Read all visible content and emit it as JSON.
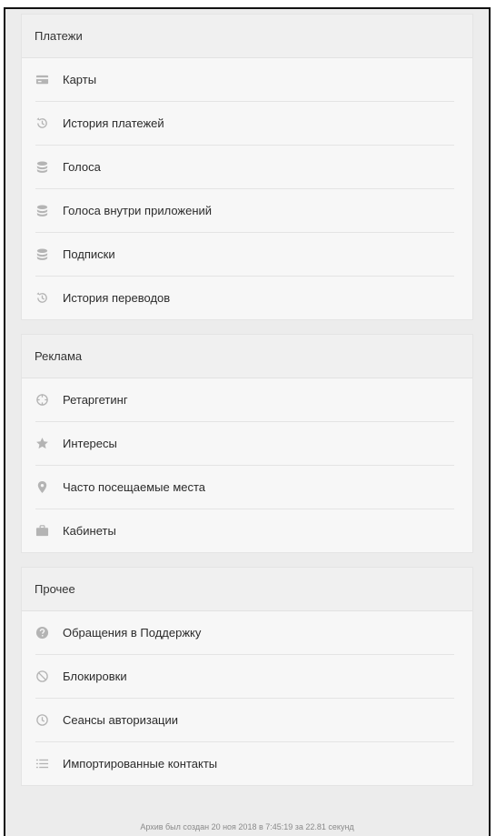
{
  "payments": {
    "title": "Платежи",
    "items": [
      {
        "label": "Карты",
        "icon": "card-icon"
      },
      {
        "label": "История платежей",
        "icon": "history-icon"
      },
      {
        "label": "Голоса",
        "icon": "coins-icon"
      },
      {
        "label": "Голоса внутри приложений",
        "icon": "coins-icon"
      },
      {
        "label": "Подписки",
        "icon": "coins-icon"
      },
      {
        "label": "История переводов",
        "icon": "history-icon"
      }
    ]
  },
  "ads": {
    "title": "Реклама",
    "items": [
      {
        "label": "Ретаргетинг",
        "icon": "target-icon"
      },
      {
        "label": "Интересы",
        "icon": "star-icon"
      },
      {
        "label": "Часто посещаемые места",
        "icon": "location-pin-icon"
      },
      {
        "label": "Кабинеты",
        "icon": "briefcase-icon"
      }
    ]
  },
  "other": {
    "title": "Прочее",
    "items": [
      {
        "label": "Обращения в Поддержку",
        "icon": "help-icon"
      },
      {
        "label": "Блокировки",
        "icon": "block-icon"
      },
      {
        "label": "Сеансы авторизации",
        "icon": "clock-icon"
      },
      {
        "label": "Импортированные контакты",
        "icon": "list-icon"
      }
    ]
  },
  "footer": {
    "text": "Архив был создан 20 ноя 2018 в 7:45:19 за 22.81 секунд"
  },
  "colors": {
    "icon": "#b4b4b4",
    "background": "#ececec",
    "card": "#f7f7f7"
  }
}
